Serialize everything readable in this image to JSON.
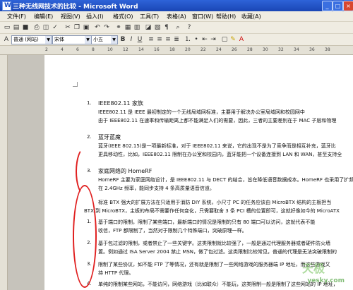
{
  "window": {
    "title": "三种无线网技术的比较 - Microsoft Word",
    "app_icon": "word-icon"
  },
  "menu": [
    "文件(F)",
    "编辑(E)",
    "视图(V)",
    "插入(I)",
    "格式(O)",
    "工具(T)",
    "表格(A)",
    "窗口(W)",
    "帮助(H)",
    "收藏(A)"
  ],
  "toolbar": {
    "style_value": "普通 (网站)",
    "font_value": "宋体",
    "size_value": "小五"
  },
  "ruler": {
    "ticks": [
      "2",
      "4",
      "6",
      "8",
      "10",
      "12",
      "14",
      "16",
      "18",
      "20",
      "22",
      "24",
      "26",
      "28",
      "30",
      "32",
      "34",
      "36",
      "38"
    ]
  },
  "document": {
    "lines": [
      {
        "num": "1.",
        "text": "IEEE802.11 家族",
        "heading": true
      },
      {
        "num": "",
        "text": "IEEE802.11 是 IEEE 最初制定的一个无线局域网标准，主要用于解决办公室局域网和校园网中"
      },
      {
        "num": "",
        "text": "由于 IEEE802.11 在速率和传输距离上都不能满足人们的需要，因此，三者的主要差别在于 MAC 子层和物理"
      },
      {
        "num": "2.",
        "text": "蓝牙蓝魔",
        "heading": true
      },
      {
        "num": "",
        "text": "蓝牙(IEEE 802.15)是一项最新标准，对于 IEEE802.11 来说，它的出现不是为了竞争而是相互补充，蓝牙比"
      },
      {
        "num": "",
        "text": "更具移动性，比如，IEEE802.11 限制在办公室和校园内，蓝牙能把一个设备连接到 LAN 和 WAN，甚至支持全"
      },
      {
        "num": "3.",
        "text": "家庭网络的 HomeRF",
        "heading": true
      },
      {
        "num": "",
        "text": "HomeRF 主要为家庭网络设计，是 IEEE802.11 与 DECT 的结合，旨在降低语音数据成本。HomeRF 也采用了扩频"
      },
      {
        "num": "",
        "text": "在 2.4GHz 频率，能同步支持 4 条高质量语音信道。"
      },
      {
        "num": "",
        "text": "标准 BTX 强大的扩展方法在只适用于消防 DIY 系统，小尺寸 PC 的任务应该由 MicroBTX 结构的主板担当"
      },
      {
        "num": "",
        "text": "BTX 到 MicroBTX，主板的布局不需要作任何变化，只需要取舍 3 条 PCI 槽的位置即可，这就好像如今的 MicroATX"
      },
      {
        "num": "1.",
        "text": "基于端口的限制，限制了某些端口，最新端口的情况是限制的只有 80 端口可以访问，这就代表不能"
      },
      {
        "num": "",
        "text": "收信，FTP 都限制了，当然对于限制几个特殊端口，突破原理一样。"
      },
      {
        "num": "2.",
        "text": "基于包过滤的限制，或者禁止了一些关键字。这类限制就比较强了，一般是通过代理服务器或者硬件防火墙"
      },
      {
        "num": "",
        "text": "置。例如通过 ISA Server 2004 禁止 MSN，做了包过滤。这类限制比较常见，普通的代理是无法突破限制的"
      },
      {
        "num": "3.",
        "text": "限制了某些协议，如不能 FTP 了等情况，还有就是限制了一些网络游戏的服务器端 IP 地址，而这些游戏又"
      },
      {
        "num": "",
        "text": "持 HTTP 代理。"
      },
      {
        "num": "4.",
        "text": "单纯的限制某些网站，不能访问，网络游戏（比如联众）不能玩，这类限制一般是限制了这些网站的 IP 地址，"
      }
    ]
  },
  "watermark": {
    "brand_cn": "天极",
    "brand_url": "yesky.com"
  },
  "colors": {
    "titlebar": "#1a46b5",
    "annotation_ellipse": "#e02020",
    "chrome": "#efece2"
  }
}
